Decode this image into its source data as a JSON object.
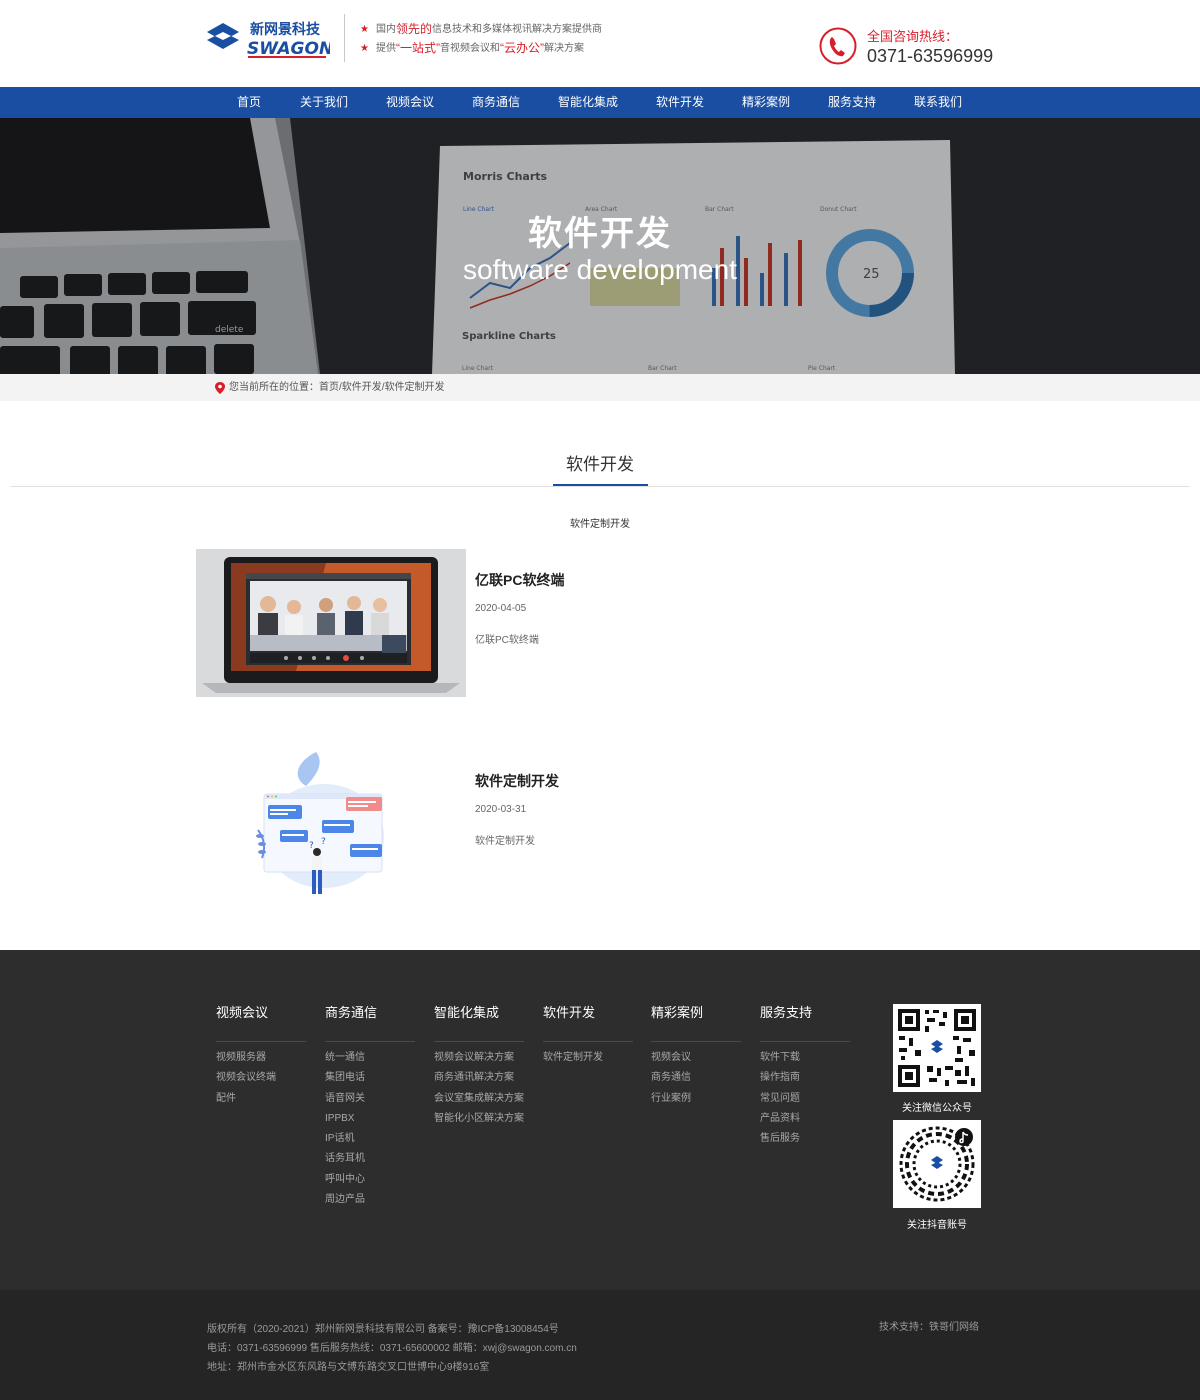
{
  "header": {
    "logo_cn": "新网景科技",
    "logo_en": "SWAGON",
    "slogan_line1_pre": "国内",
    "slogan_line1_hl": "领先的",
    "slogan_line1_post": "信息技术和多媒体视讯解决方案提供商",
    "slogan_line2_pre": "提供",
    "slogan_line2_hl1": "“一站式”",
    "slogan_line2_mid": "音视频会议和",
    "slogan_line2_hl2": "“云办公”",
    "slogan_line2_post": "解决方案",
    "hotline_label": "全国咨询热线：",
    "hotline_number": "0371-63596999"
  },
  "nav": {
    "items": [
      {
        "label": "首页"
      },
      {
        "label": "关于我们"
      },
      {
        "label": "视频会议"
      },
      {
        "label": "商务通信"
      },
      {
        "label": "智能化集成"
      },
      {
        "label": "软件开发"
      },
      {
        "label": "精彩案例"
      },
      {
        "label": "服务支持"
      },
      {
        "label": "联系我们"
      }
    ]
  },
  "banner": {
    "title": "软件开发",
    "subtitle": "software development",
    "paper_title": "Morris Charts",
    "paper_line": "Line Chart",
    "paper_area": "Area Chart",
    "paper_bar": "Bar Chart",
    "paper_donut": "Donut Chart",
    "paper_donut_value": "25",
    "paper_sparkline": "Sparkline Charts",
    "paper_bar2": "Bar Chart",
    "paper_pie": "Pie Chart",
    "key_delete": "delete"
  },
  "breadcrumb": {
    "prefix": "您当前所在的位置：",
    "home": "首页",
    "sep1": "/ ",
    "level1": "软件开发",
    "sep2": "/ ",
    "level2": "软件定制开发"
  },
  "section": {
    "title": "软件开发",
    "sub_category": "软件定制开发"
  },
  "articles": [
    {
      "title": "亿联PC软终端",
      "date": "2020-04-05",
      "desc": "亿联PC软终端"
    },
    {
      "title": "软件定制开发",
      "date": "2020-03-31",
      "desc": "软件定制开发"
    }
  ],
  "footer": {
    "columns": [
      {
        "title": "视频会议",
        "links": [
          "视频服务器",
          "视频会议终端",
          "配件"
        ]
      },
      {
        "title": "商务通信",
        "links": [
          "统一通信",
          "集团电话",
          "语音网关",
          "IPPBX",
          "IP话机",
          "话务耳机",
          "呼叫中心",
          "周边产品"
        ]
      },
      {
        "title": "智能化集成",
        "links": [
          "视频会议解决方案",
          "商务通讯解决方案",
          "会议室集成解决方案",
          "智能化小区解决方案"
        ]
      },
      {
        "title": "软件开发",
        "links": [
          "软件定制开发"
        ]
      },
      {
        "title": "精彩案例",
        "links": [
          "视频会议",
          "商务通信",
          "行业案例"
        ]
      },
      {
        "title": "服务支持",
        "links": [
          "软件下载",
          "操作指南",
          "常见问题",
          "产品资料",
          "售后服务"
        ]
      }
    ],
    "qr_wechat_label": "关注微信公众号",
    "qr_douyin_label": "关注抖音账号"
  },
  "bottom": {
    "copyright": "版权所有（2020-2021）郑州新网景科技有限公司 备案号：豫ICP备13008454号",
    "contact": "电话：0371-63596999 售后服务热线：0371-65600002 邮箱：xwj@swagon.com.cn",
    "address": "地址：郑州市金水区东风路与文博东路交叉口世博中心9楼916室",
    "tech_support": "技术支持：铁哥们网络"
  },
  "colors": {
    "brand_blue": "#1a4ea3",
    "accent_red": "#d81e2a",
    "footer_bg": "#2d2d2d"
  }
}
